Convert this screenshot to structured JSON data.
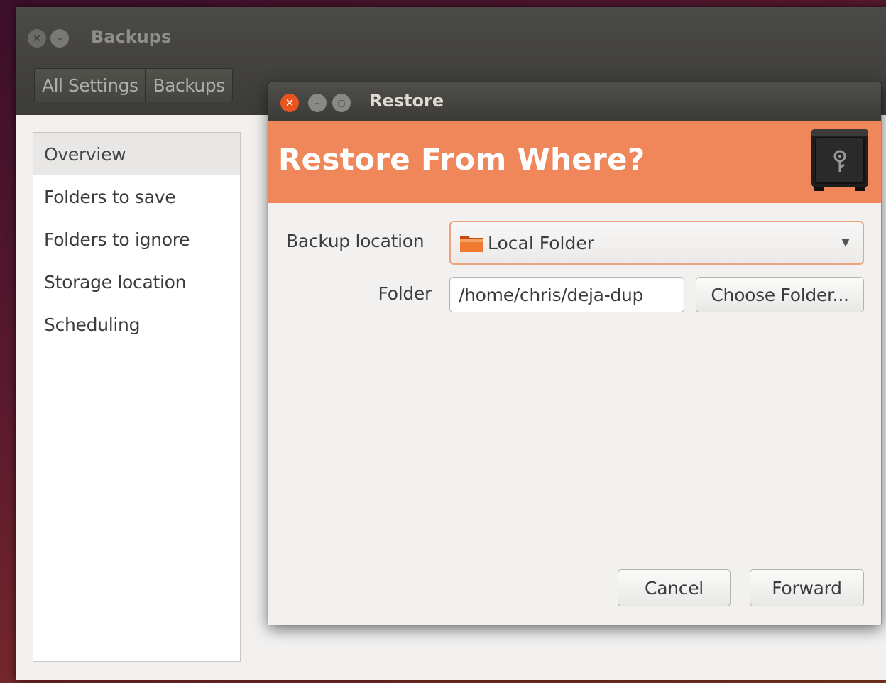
{
  "main_window": {
    "title": "Backups",
    "nav": [
      "All Settings",
      "Backups"
    ],
    "sidebar": {
      "items": [
        {
          "label": "Overview",
          "selected": true
        },
        {
          "label": "Folders to save",
          "selected": false
        },
        {
          "label": "Folders to ignore",
          "selected": false
        },
        {
          "label": "Storage location",
          "selected": false
        },
        {
          "label": "Scheduling",
          "selected": false
        }
      ]
    }
  },
  "dialog": {
    "title": "Restore",
    "banner_title": "Restore From Where?",
    "banner_icon": "safe-icon",
    "backup_location": {
      "label": "Backup location",
      "selected": "Local Folder",
      "icon": "folder-icon"
    },
    "folder": {
      "label": "Folder",
      "value": "/home/chris/deja-dup",
      "choose_label": "Choose Folder..."
    },
    "buttons": {
      "cancel": "Cancel",
      "forward": "Forward"
    }
  },
  "colors": {
    "accent": "#f0875a",
    "close_button": "#e95420",
    "titlebar": "#3c3b37",
    "combo_focus_border": "#f0a27f"
  }
}
